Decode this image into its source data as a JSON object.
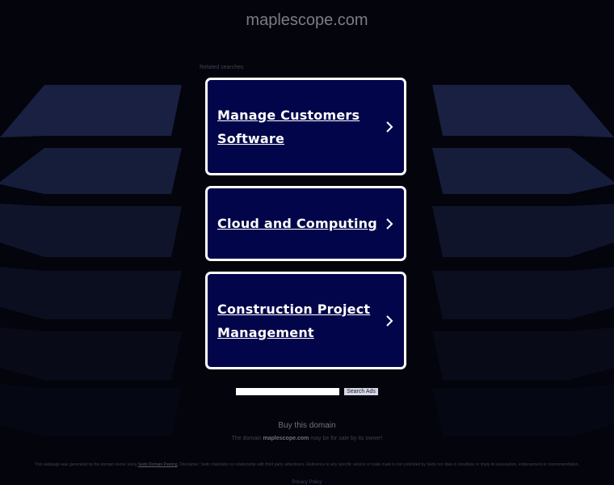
{
  "header": {
    "domain": "maplescope.com"
  },
  "related": {
    "label": "Related searches"
  },
  "ads": [
    {
      "label": "Manage Customers Software"
    },
    {
      "label": "Cloud and Computing"
    },
    {
      "label": "Construction Project Management"
    }
  ],
  "search": {
    "placeholder": "",
    "button_label": "Search Ads"
  },
  "footer": {
    "buy_label": "Buy this domain",
    "sale_prefix": "The domain",
    "sale_domain": "maplescope.com",
    "sale_suffix": "may be for sale by its owner!",
    "disclaimer_prefix": "This webpage was generated by the domain owner using",
    "disclaimer_link": "Sedo Domain Parking",
    "disclaimer_suffix": ". Disclaimer: Sedo maintains no relationship with third party advertisers. Reference to any specific service or trade mark is not controlled by Sedo nor does it constitute or imply its association, endorsement or recommendation.",
    "privacy_label": "Privacy Policy"
  },
  "colors": {
    "background": "#03040c",
    "card": "#02054a",
    "card_border": "#ffffff",
    "panel": "#1a2242"
  }
}
